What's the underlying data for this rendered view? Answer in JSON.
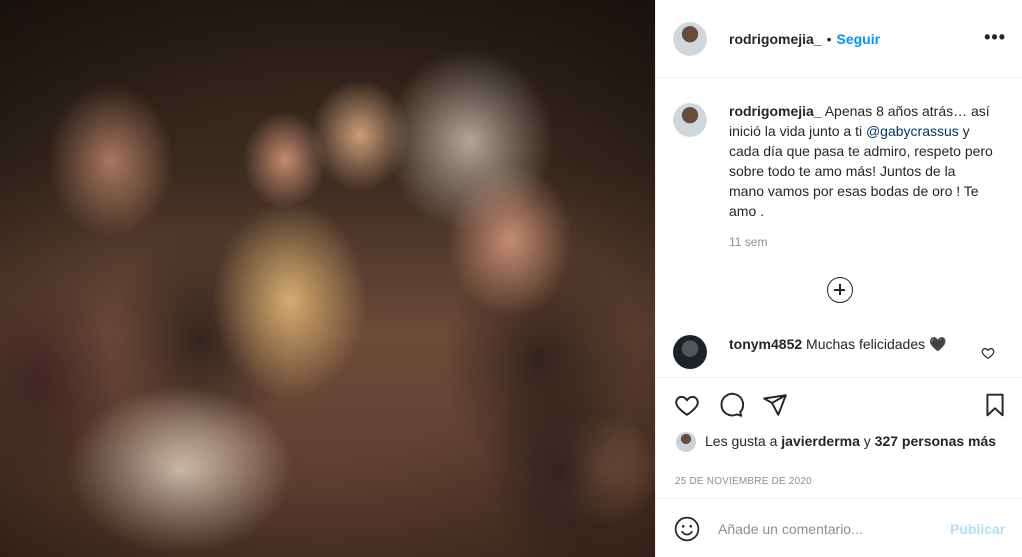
{
  "post": {
    "image_alt": "Foto de celebración en boda"
  },
  "header": {
    "username": "rodrigomejia_",
    "separator": "•",
    "follow_label": "Seguir",
    "more_icon": "more-options-icon"
  },
  "caption": {
    "username": "rodrigomejia_",
    "text_1": " Apenas 8 años atrás… así inició la vida junto a ti ",
    "mention": "@gabycrassus",
    "text_2": " y cada día que pasa te admiro, respeto pero sobre todo te amo más! Juntos de la mano vamos por esas bodas de oro ! Te amo .",
    "time": "11 sem"
  },
  "comments": [
    {
      "username": "tonym4852",
      "text": " Muchas felicidades 🖤"
    }
  ],
  "actions": {
    "like_icon": "heart-icon",
    "comment_icon": "comment-icon",
    "share_icon": "share-icon",
    "save_icon": "bookmark-icon"
  },
  "likes": {
    "prefix": "Les gusta a ",
    "user": "javierderma",
    "connector": " y ",
    "others": "327 personas más"
  },
  "date": "25 DE NOVIEMBRE DE 2020",
  "add_comment": {
    "placeholder": "Añade un comentario...",
    "publish_label": "Publicar"
  },
  "colors": {
    "accent": "#0095f6",
    "publish_disabled": "#b2dffc",
    "mention": "#00376b",
    "muted": "#8e8e8e"
  }
}
